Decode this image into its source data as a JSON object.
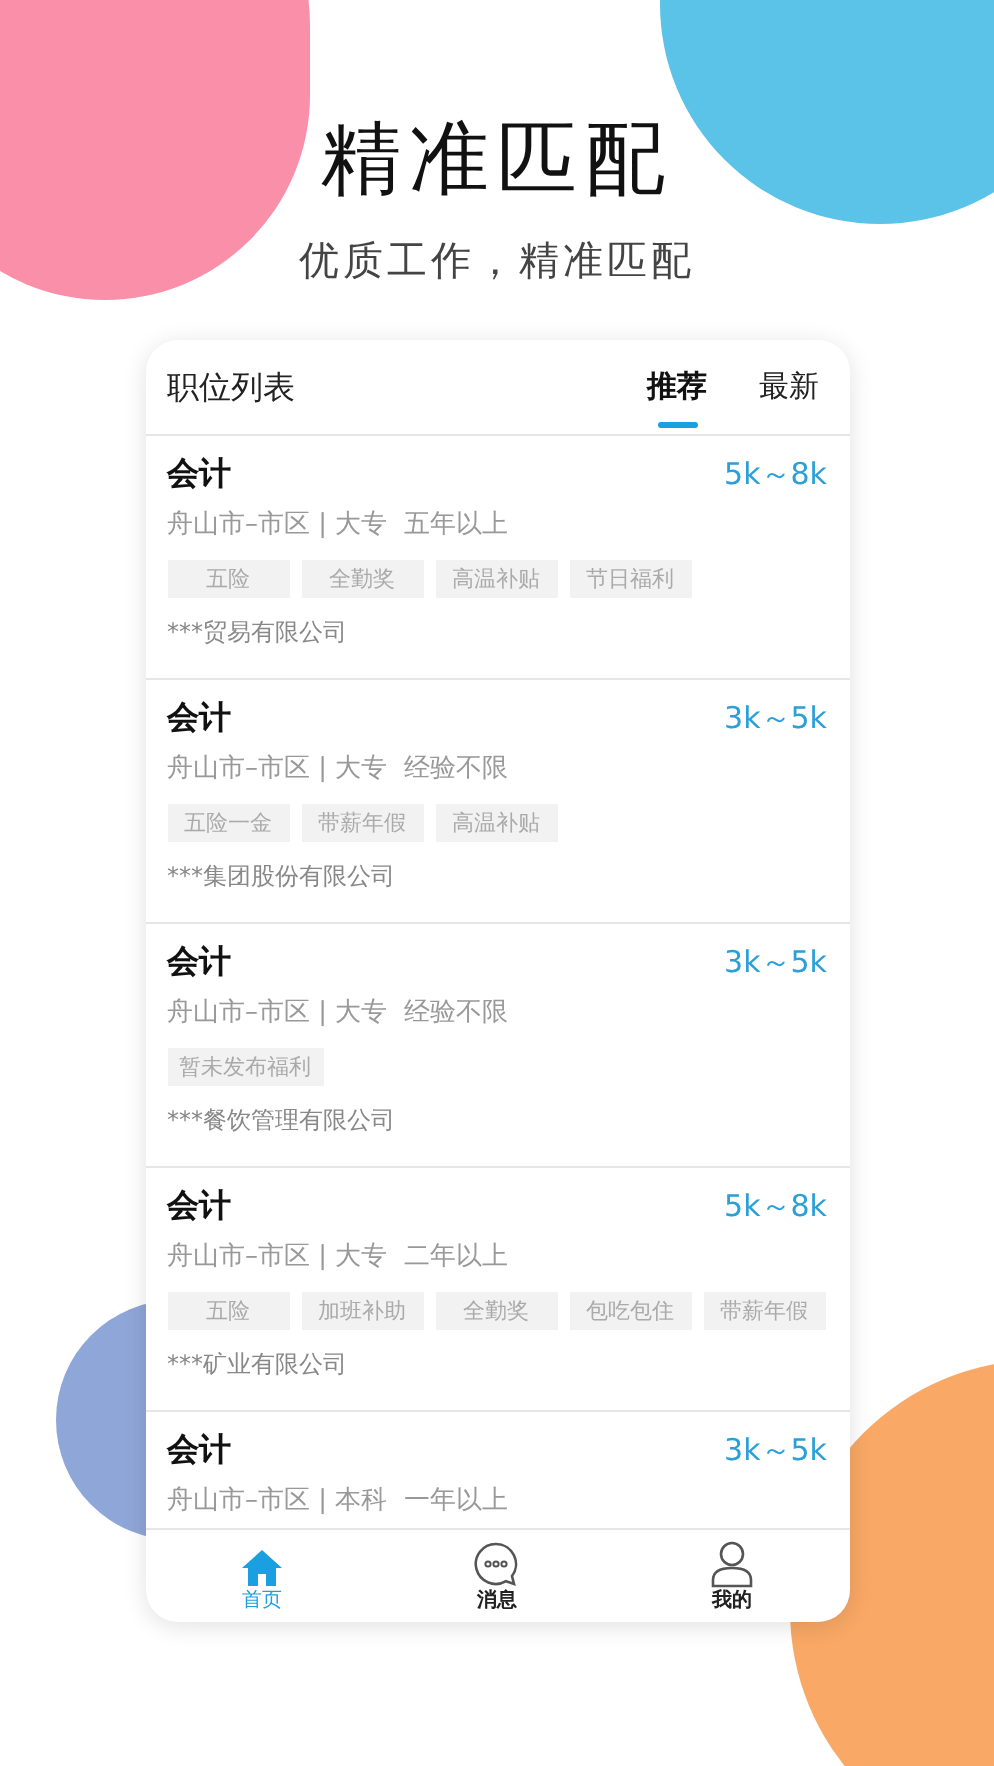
{
  "headline": "精准匹配",
  "subtitle": "优质工作，精准匹配",
  "header": {
    "title": "职位列表",
    "tabs": [
      {
        "label": "推荐",
        "selected": true
      },
      {
        "label": "最新",
        "selected": false
      }
    ]
  },
  "jobs": [
    {
      "title": "会计",
      "salary": "5k～8k",
      "details": "舟山市–市区 | 大专  五年以上",
      "tags": [
        "五险",
        "全勤奖",
        "高温补贴",
        "节日福利"
      ],
      "company": "***贸易有限公司"
    },
    {
      "title": "会计",
      "salary": "3k～5k",
      "details": "舟山市–市区 | 大专  经验不限",
      "tags": [
        "五险一金",
        "带薪年假",
        "高温补贴"
      ],
      "company": "***集团股份有限公司"
    },
    {
      "title": "会计",
      "salary": "3k～5k",
      "details": "舟山市–市区 | 大专  经验不限",
      "tags": [
        "暂未发布福利"
      ],
      "company": "***餐饮管理有限公司"
    },
    {
      "title": "会计",
      "salary": "5k～8k",
      "details": "舟山市–市区 | 大专  二年以上",
      "tags": [
        "五险",
        "加班补助",
        "全勤奖",
        "包吃包住",
        "带薪年假"
      ],
      "company": "***矿业有限公司"
    },
    {
      "title": "会计",
      "salary": "3k～5k",
      "details": "舟山市–市区 | 本科  一年以上"
    }
  ],
  "nav": [
    {
      "kind": "home",
      "label": "首页",
      "selected": true
    },
    {
      "kind": "message",
      "label": "消息",
      "selected": false
    },
    {
      "kind": "profile",
      "label": "我的",
      "selected": false
    }
  ]
}
